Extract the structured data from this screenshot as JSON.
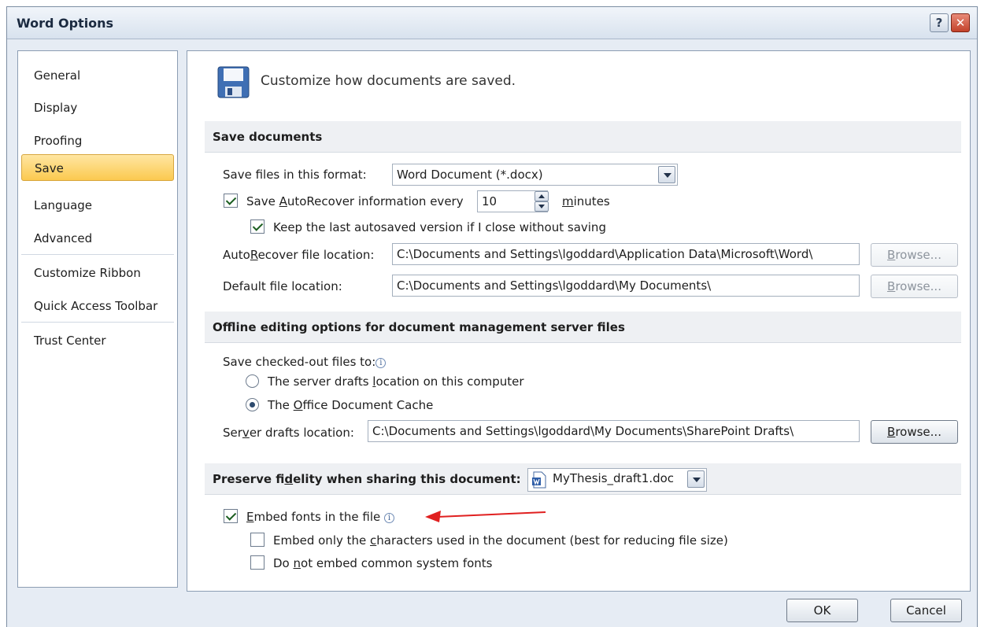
{
  "window": {
    "title": "Word Options",
    "help_label": "?",
    "close_label": "✕"
  },
  "sidebar": {
    "items": [
      {
        "label": "General"
      },
      {
        "label": "Display"
      },
      {
        "label": "Proofing"
      },
      {
        "label": "Save"
      },
      {
        "label": "Language"
      },
      {
        "label": "Advanced"
      },
      {
        "label": "Customize Ribbon"
      },
      {
        "label": "Quick Access Toolbar"
      },
      {
        "label": "Trust Center"
      }
    ],
    "selected": "Save"
  },
  "header": {
    "text": "Customize how documents are saved."
  },
  "save_documents": {
    "title": "Save documents",
    "format_label": "Save files in this format:",
    "format_value": "Word Document (*.docx)",
    "autorecover": {
      "checked": true,
      "label_pre": "Save ",
      "label_u": "A",
      "label_post": "utoRecover information every",
      "value": "10",
      "unit_u": "m",
      "unit_post": "inutes"
    },
    "keep_last": {
      "checked": true,
      "label": "Keep the last autosaved version if I close without saving"
    },
    "autorecover_location": {
      "label_pre": "Auto",
      "label_u": "R",
      "label_post": "ecover file location:",
      "value": "C:\\Documents and Settings\\lgoddard\\Application Data\\Microsoft\\Word\\",
      "button_u": "B",
      "button_post": "rowse..."
    },
    "default_location": {
      "label_pre": "Default f",
      "label_u": "i",
      "label_post": "le location:",
      "value": "C:\\Documents and Settings\\lgoddard\\My Documents\\",
      "button_u": "B",
      "button_post": "rowse..."
    }
  },
  "offline": {
    "title": "Offline editing options for document management server files",
    "save_to_label": "Save checked-out files to:",
    "info_symbol": "i",
    "options": [
      {
        "pre": "The server drafts ",
        "u": "l",
        "post": "ocation on this computer",
        "selected": false
      },
      {
        "pre": "The ",
        "u": "O",
        "post": "ffice Document Cache",
        "selected": true
      }
    ],
    "server_drafts": {
      "label_pre": "Ser",
      "label_u": "v",
      "label_post": "er drafts location:",
      "value": "C:\\Documents and Settings\\lgoddard\\My Documents\\SharePoint Drafts\\",
      "button_u": "B",
      "button_post": "rowse..."
    }
  },
  "fidelity": {
    "title_pre": "Preserve fi",
    "title_u": "d",
    "title_post": "elity when sharing this document:",
    "document": "MyThesis_draft1.doc",
    "embed_fonts": {
      "checked": true,
      "u": "E",
      "post": "mbed fonts in the file"
    },
    "embed_only": {
      "checked": false,
      "pre": "Embed only the ",
      "u": "c",
      "post": "haracters used in the document (best for reducing file size)"
    },
    "do_not_embed": {
      "checked": false,
      "pre": "Do ",
      "u": "n",
      "post": "ot embed common system fonts"
    }
  },
  "footer": {
    "ok": "OK",
    "cancel": "Cancel"
  },
  "colors": {
    "selected_nav": "#fbc94f",
    "annotation_arrow": "#e02020"
  }
}
